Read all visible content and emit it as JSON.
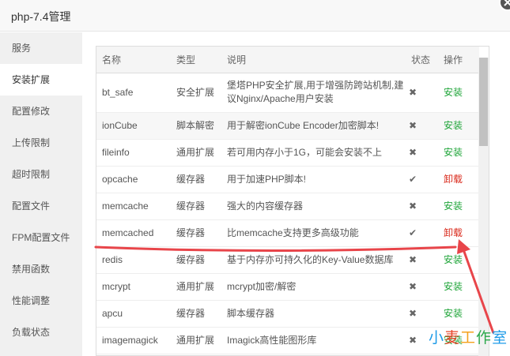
{
  "window": {
    "title": "php-7.4管理"
  },
  "sidebar": {
    "items": [
      {
        "label": "服务"
      },
      {
        "label": "安装扩展"
      },
      {
        "label": "配置修改"
      },
      {
        "label": "上传限制"
      },
      {
        "label": "超时限制"
      },
      {
        "label": "配置文件"
      },
      {
        "label": "FPM配置文件"
      },
      {
        "label": "禁用函数"
      },
      {
        "label": "性能调整"
      },
      {
        "label": "负载状态"
      }
    ],
    "active_index": 1
  },
  "table": {
    "columns": [
      "名称",
      "类型",
      "说明",
      "状态",
      "操作"
    ],
    "rows": [
      {
        "name": "bt_safe",
        "type": "安全扩展",
        "desc": "堡塔PHP安全扩展,用于增强防跨站机制,建议Nginx/Apache用户安装",
        "status": "✖",
        "action": "安装",
        "installed": false
      },
      {
        "name": "ionCube",
        "type": "脚本解密",
        "desc": "用于解密ionCube Encoder加密脚本!",
        "status": "✖",
        "action": "安装",
        "installed": false
      },
      {
        "name": "fileinfo",
        "type": "通用扩展",
        "desc": "若可用内存小于1G，可能会安装不上",
        "status": "✖",
        "action": "安装",
        "installed": false
      },
      {
        "name": "opcache",
        "type": "缓存器",
        "desc": "用于加速PHP脚本!",
        "status": "✔",
        "action": "卸载",
        "installed": true
      },
      {
        "name": "memcache",
        "type": "缓存器",
        "desc": "强大的内容缓存器",
        "status": "✖",
        "action": "安装",
        "installed": false
      },
      {
        "name": "memcached",
        "type": "缓存器",
        "desc": "比memcache支持更多高级功能",
        "status": "✔",
        "action": "卸载",
        "installed": true
      },
      {
        "name": "redis",
        "type": "缓存器",
        "desc": "基于内存亦可持久化的Key-Value数据库",
        "status": "✖",
        "action": "安装",
        "installed": false
      },
      {
        "name": "mcrypt",
        "type": "通用扩展",
        "desc": "mcrypt加密/解密",
        "status": "✖",
        "action": "安装",
        "installed": false
      },
      {
        "name": "apcu",
        "type": "缓存器",
        "desc": "脚本缓存器",
        "status": "✖",
        "action": "安装",
        "installed": false
      },
      {
        "name": "imagemagick",
        "type": "通用扩展",
        "desc": "Imagick高性能图形库",
        "status": "✖",
        "action": "安装",
        "installed": false
      }
    ]
  },
  "watermark": {
    "chars": [
      "小",
      "麦",
      "工",
      "作",
      "室"
    ]
  },
  "colors": {
    "install": "#20a53a",
    "uninstall": "#d9281a",
    "annotation": "#e8454a",
    "watermark": [
      "#1e9be8",
      "#e8452a",
      "#f4a11d",
      "#2aa84a",
      "#1e9be8"
    ]
  }
}
